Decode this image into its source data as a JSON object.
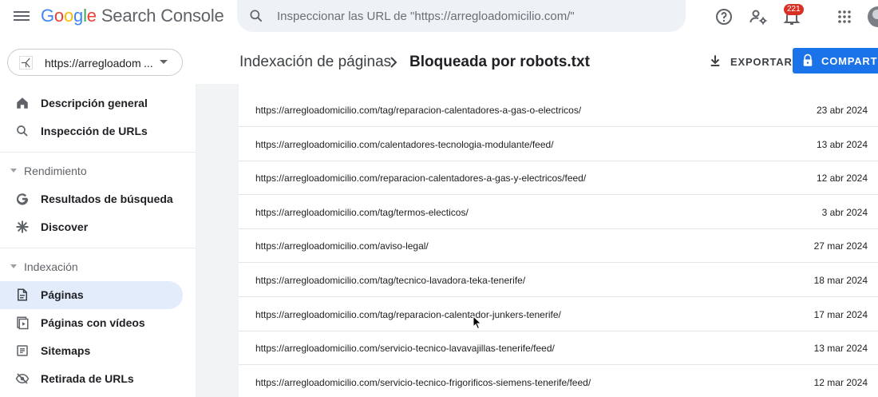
{
  "app": {
    "logo_google": [
      "G",
      "o",
      "o",
      "g",
      "l",
      "e"
    ],
    "logo_product": "Search Console",
    "search_placeholder": "Inspeccionar las URL de \"https://arregloadomicilio.com/\"",
    "notifications_count": "221"
  },
  "icons": {
    "menu": "hamburger-menu-icon",
    "search": "search-icon",
    "help": "help-icon",
    "manage_users": "manage-users-icon",
    "notifications": "notifications-icon",
    "apps": "apps-grid-icon"
  },
  "sidebar": {
    "property_label": "https://arregloadom",
    "property_ellipsis": "...",
    "items_top": [
      {
        "label": "Descripción general",
        "icon": "home-icon"
      },
      {
        "label": "Inspección de URLs",
        "icon": "search-icon"
      }
    ],
    "section_rendimiento": "Rendimiento",
    "items_rendimiento": [
      {
        "label": "Resultados de búsqueda",
        "icon": "google-g-icon"
      },
      {
        "label": "Discover",
        "icon": "asterisk-icon"
      }
    ],
    "section_indexacion": "Indexación",
    "items_indexacion": [
      {
        "label": "Páginas",
        "icon": "pages-icon",
        "selected": true
      },
      {
        "label": "Páginas con vídeos",
        "icon": "video-pages-icon"
      },
      {
        "label": "Sitemaps",
        "icon": "sitemaps-icon"
      },
      {
        "label": "Retirada de URLs",
        "icon": "removals-icon"
      }
    ]
  },
  "header": {
    "breadcrumb_parent": "Indexación de páginas",
    "breadcrumb_current": "Bloqueada por robots.txt",
    "export_label": "EXPORTAR",
    "share_label": "COMPARTIR"
  },
  "rows": [
    {
      "url": "https://arregloadomicilio.com/tag/reparacion-calentadores-a-gas-o-electricos/",
      "date": "23 abr 2024"
    },
    {
      "url": "https://arregloadomicilio.com/calentadores-tecnologia-modulante/feed/",
      "date": "13 abr 2024"
    },
    {
      "url": "https://arregloadomicilio.com/reparacion-calentadores-a-gas-y-electricos/feed/",
      "date": "12 abr 2024"
    },
    {
      "url": "https://arregloadomicilio.com/tag/termos-electicos/",
      "date": "3 abr 2024"
    },
    {
      "url": "https://arregloadomicilio.com/aviso-legal/",
      "date": "27 mar 2024"
    },
    {
      "url": "https://arregloadomicilio.com/tag/tecnico-lavadora-teka-tenerife/",
      "date": "18 mar 2024"
    },
    {
      "url": "https://arregloadomicilio.com/tag/reparacion-calentador-junkers-tenerife/",
      "date": "17 mar 2024"
    },
    {
      "url": "https://arregloadomicilio.com/servicio-tecnico-lavavajillas-tenerife/feed/",
      "date": "13 mar 2024"
    },
    {
      "url": "https://arregloadomicilio.com/servicio-tecnico-frigorificos-siemens-tenerife/feed/",
      "date": "12 mar 2024"
    }
  ],
  "colors": {
    "accent": "#1a73e8",
    "selected_bg": "#e3ecfb",
    "badge": "#d93025"
  }
}
